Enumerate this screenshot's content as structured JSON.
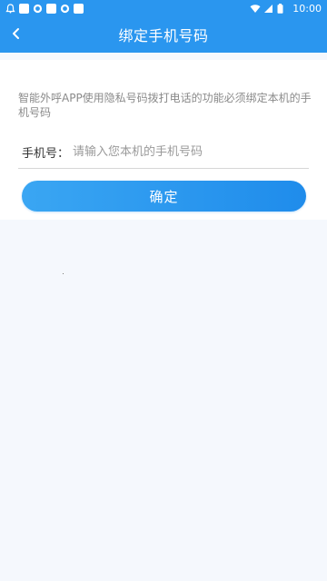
{
  "status_bar": {
    "time": "10:00",
    "icons": [
      "notification-icon",
      "square-icon",
      "ring-icon",
      "square-icon",
      "ring-icon",
      "square-icon"
    ],
    "right_icons": [
      "wifi-icon",
      "signal-icon",
      "battery-icon"
    ]
  },
  "header": {
    "title": "绑定手机号码",
    "back_icon": "chevron-left-icon"
  },
  "form": {
    "notice": "智能外呼APP使用隐私号码拨打电话的功能必须绑定本机的手机号码",
    "phone_label": "手机号：",
    "phone_value": "",
    "phone_placeholder": "请输入您本机的手机号码",
    "confirm_label": "确定"
  },
  "colors": {
    "primary": "#2a96ef",
    "background": "#f5f8fd",
    "card": "#ffffff",
    "notice_text": "#8a8a8a"
  }
}
